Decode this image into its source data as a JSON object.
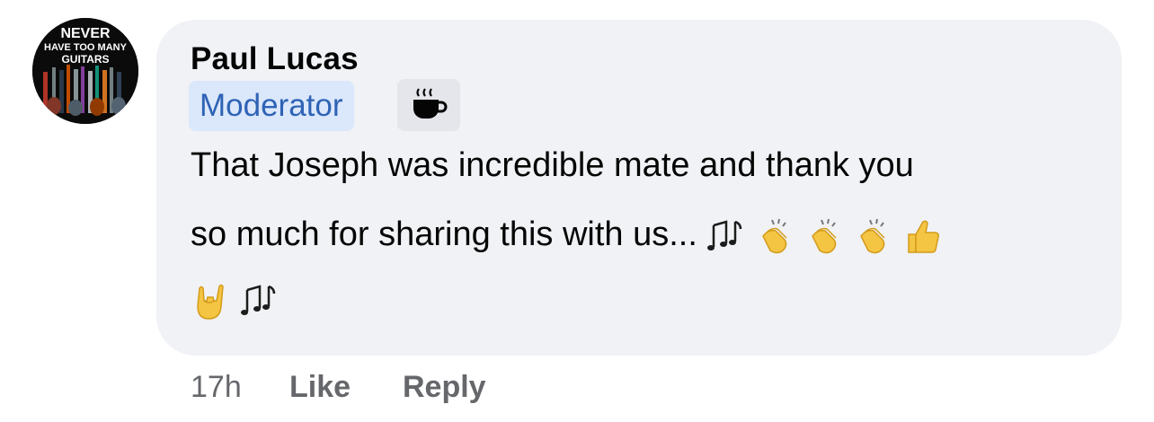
{
  "avatar": {
    "logo_text_line1": "NEVER",
    "logo_text_line2": "HAVE TOO MANY",
    "logo_text_line3": "GUITARS"
  },
  "comment": {
    "author": "Paul Lucas",
    "badges": {
      "role": "Moderator",
      "secondary_icon": "coffee-cup-icon"
    },
    "text_line1": "That Joseph was incredible mate and thank you",
    "text_line2": "so much for sharing this with us...",
    "emoji_line2": [
      "musical-notes-icon",
      "clapping-hands-icon",
      "clapping-hands-icon",
      "clapping-hands-icon",
      "thumbs-up-icon"
    ],
    "emoji_line3": [
      "sign-of-the-horns-icon",
      "musical-notes-icon"
    ]
  },
  "footer": {
    "time": "17h",
    "like_label": "Like",
    "reply_label": "Reply"
  },
  "colors": {
    "bubble": "#f0f2f5",
    "moderator_bg": "#dbe7fb",
    "moderator_text": "#2e63b5",
    "meta_text": "#65676b"
  }
}
